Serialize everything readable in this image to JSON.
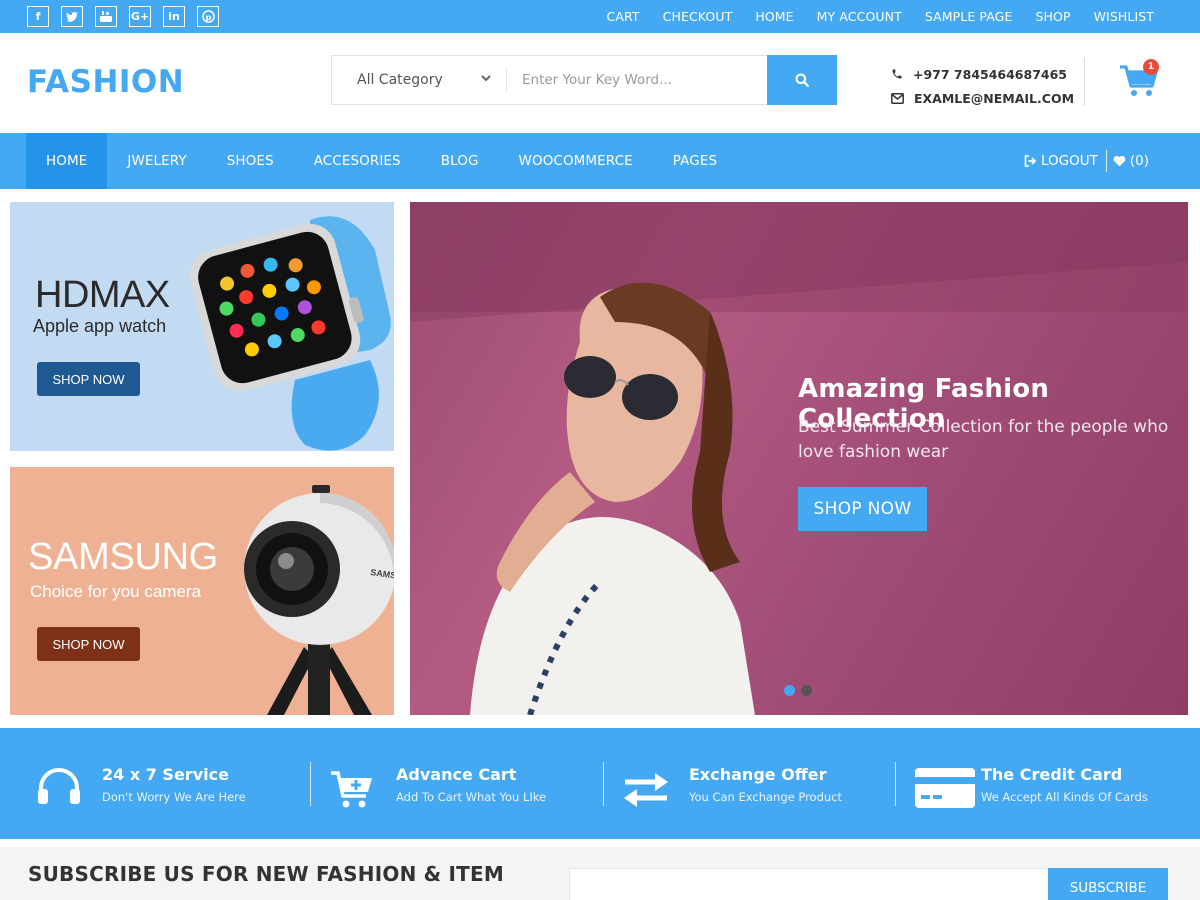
{
  "topbar": {
    "social": [
      {
        "name": "facebook-icon",
        "glyph": "f"
      },
      {
        "name": "twitter-icon",
        "glyph": "t"
      },
      {
        "name": "youtube-icon",
        "glyph": "▶"
      },
      {
        "name": "googleplus-icon",
        "glyph": "G+"
      },
      {
        "name": "linkedin-icon",
        "glyph": "in"
      },
      {
        "name": "pinterest-icon",
        "glyph": "p"
      }
    ],
    "links": [
      "CART",
      "CHECKOUT",
      "HOME",
      "MY ACCOUNT",
      "SAMPLE PAGE",
      "SHOP",
      "WISHLIST"
    ]
  },
  "header": {
    "logo": "FASHION",
    "category_label": "All Category",
    "search_placeholder": "Enter Your Key Word...",
    "phone": "+977 7845464687465",
    "email": "EXAMLE@NEMAIL.COM",
    "cart_count": "1"
  },
  "nav": {
    "items": [
      "HOME",
      "JWELERY",
      "SHOES",
      "ACCESORIES",
      "BLOG",
      "WOOCOMMERCE",
      "PAGES"
    ],
    "active_index": 0,
    "logout": "LOGOUT",
    "wishlist": "(0)"
  },
  "banners": {
    "left_top": {
      "title": "HDMAX",
      "subtitle": "Apple app watch",
      "button": "SHOP NOW"
    },
    "left_bottom": {
      "title": "SAMSUNG",
      "subtitle": "Choice for you camera",
      "button": "SHOP NOW",
      "brand_print": "SAMS"
    },
    "hero": {
      "title": "Amazing Fashion Collection",
      "subtitle": "Best Summer Collection for the people who love fashion wear",
      "button": "SHOP NOW",
      "slides": 2,
      "active_slide": 0
    }
  },
  "features": [
    {
      "icon": "headphones-icon",
      "title": "24 x 7 Service",
      "desc": "Don't Worry We Are Here"
    },
    {
      "icon": "cart-plus-icon",
      "title": "Advance Cart",
      "desc": "Add To Cart What You LIke"
    },
    {
      "icon": "exchange-icon",
      "title": "Exchange Offer",
      "desc": "You Can Exchange Product"
    },
    {
      "icon": "credit-card-icon",
      "title": "The Credit Card",
      "desc": "We Accept All Kinds Of Cards"
    }
  ],
  "subscribe": {
    "heading": "SUBSCRIBE US FOR NEW FASHION & ITEM",
    "button": "SUBSCRIBE"
  },
  "colors": {
    "accent": "#44a8f2",
    "accent_dark": "#2693ea",
    "badge": "#e74c3c"
  }
}
